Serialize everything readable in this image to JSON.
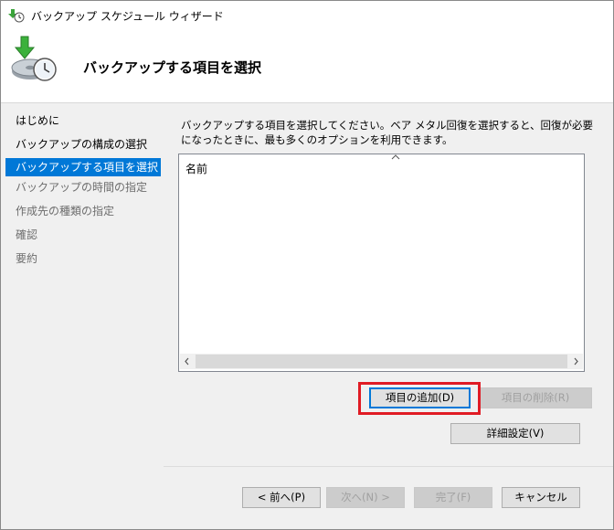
{
  "window": {
    "title": "バックアップ スケジュール ウィザード"
  },
  "header": {
    "title": "バックアップする項目を選択",
    "icon": "backup-clock-icon"
  },
  "nav": {
    "items": [
      {
        "label": "はじめに",
        "state": "done"
      },
      {
        "label": "バックアップの構成の選択",
        "state": "done"
      },
      {
        "label": "バックアップする項目を選択",
        "state": "current"
      },
      {
        "label": "バックアップの時間の指定",
        "state": "future"
      },
      {
        "label": "作成先の種類の指定",
        "state": "future"
      },
      {
        "label": "確認",
        "state": "future"
      },
      {
        "label": "要約",
        "state": "future"
      }
    ]
  },
  "main": {
    "description": "バックアップする項目を選択してください。ベア メタル回復を選択すると、回復が必要になったときに、最も多くのオプションを利用できます。",
    "list": {
      "column_header": "名前",
      "rows": []
    },
    "buttons": {
      "add_items": "項目の追加(D)",
      "remove_items": "項目の削除(R)",
      "advanced_settings": "詳細設定(V)"
    }
  },
  "footer": {
    "back": "< 前へ(P)",
    "next": "次へ(N) >",
    "finish": "完了(F)",
    "cancel": "キャンセル"
  },
  "colors": {
    "selection": "#0078d7",
    "highlight_box": "#e01b24"
  }
}
